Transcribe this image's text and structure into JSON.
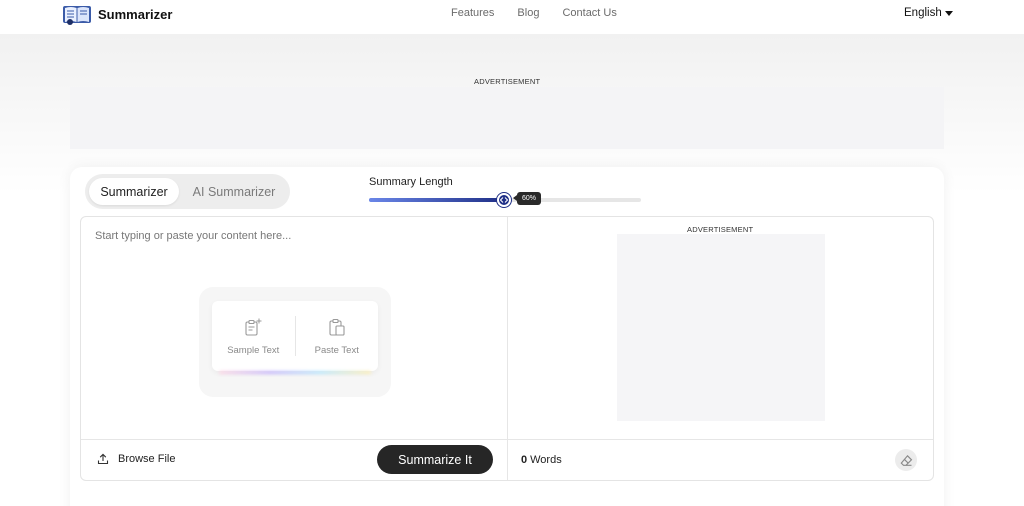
{
  "header": {
    "brand": "Summarizer",
    "nav": [
      "Features",
      "Blog",
      "Contact Us"
    ],
    "language": "English"
  },
  "ads": {
    "top_label": "ADVERTISEMENT",
    "right_label": "ADVERTISEMENT"
  },
  "modes": {
    "active": "Summarizer",
    "inactive": "AI Summarizer"
  },
  "summary_length": {
    "label": "Summary Length",
    "value_percent": 60,
    "display": "60%"
  },
  "editor": {
    "placeholder": "Start typing or paste your content here...",
    "sample_text_label": "Sample Text",
    "paste_text_label": "Paste Text"
  },
  "footer": {
    "browse_label": "Browse File",
    "summarize_label": "Summarize It",
    "word_count": "0",
    "word_unit": "Words"
  },
  "colors": {
    "slider_accent": "#1f2f86",
    "button_dark": "#262626"
  },
  "icons": [
    "logo-book-icon",
    "caret-down-icon",
    "slider-arrows-icon",
    "sample-text-icon",
    "paste-text-icon",
    "upload-icon",
    "eraser-icon"
  ]
}
